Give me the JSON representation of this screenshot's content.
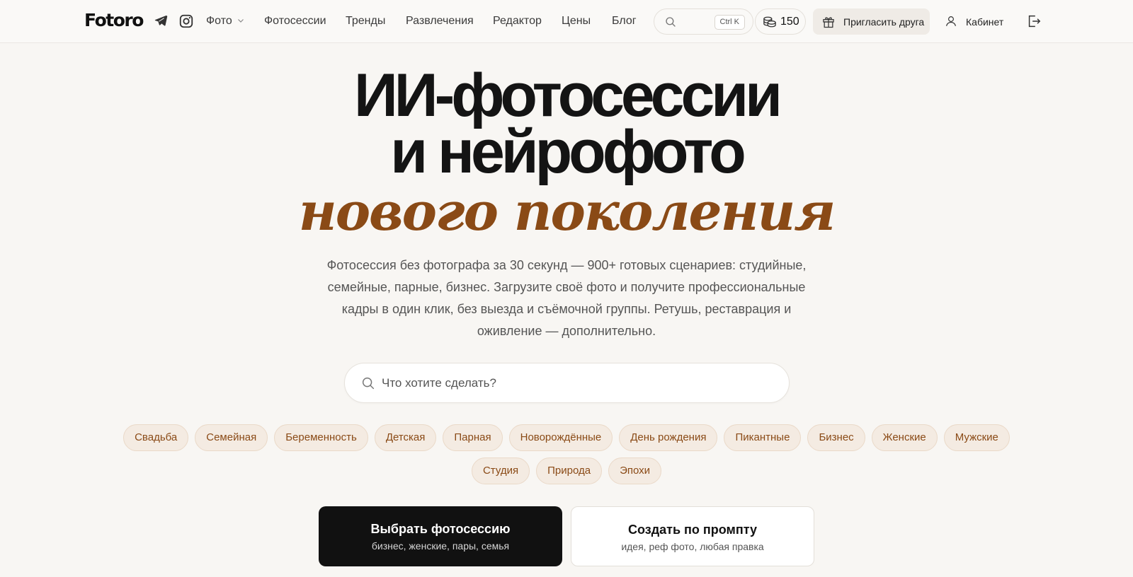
{
  "colors": {
    "accent": "#8a4a16",
    "chip_bg": "#f4ebe2",
    "page_bg": "#f8f6f3",
    "cta_dark": "#111111"
  },
  "header": {
    "logo": "Fotoro",
    "social_icons": [
      "telegram-icon",
      "instagram-icon"
    ],
    "nav": {
      "foto": "Фото",
      "sessions": "Фотосессии",
      "trends": "Тренды",
      "fun": "Развлечения",
      "editor": "Редактор",
      "prices": "Цены",
      "blog": "Блог"
    },
    "search_shortcut": "Ctrl K",
    "credits": "150",
    "invite_label": "Пригласить друга",
    "cabinet_label": "Кабинет"
  },
  "hero": {
    "title_line1": "ИИ-фотосессии",
    "title_line2": "и нейрофото",
    "title_line3": "нового поколения",
    "subtitle": "Фотосессия без фотографа за 30 секунд — 900+ готовых сценариев: студийные, семейные, парные, бизнес. Загрузите своё фото и получите профессиональные кадры в один клик, без выезда и съёмочной группы. Ретушь, реставрация и оживление — дополнительно.",
    "search_placeholder": "Что хотите сделать?"
  },
  "chips_row1": [
    "Свадьба",
    "Семейная",
    "Беременность",
    "Детская",
    "Парная",
    "Новорождённые",
    "День рождения",
    "Пикантные",
    "Бизнес",
    "Женские",
    "Мужские"
  ],
  "chips_row2": [
    "Студия",
    "Природа",
    "Эпохи"
  ],
  "cta": {
    "primary_title": "Выбрать фотосессию",
    "primary_sub": "бизнес, женские, пары, семья",
    "secondary_title": "Создать по промпту",
    "secondary_sub": "идея, реф фото, любая правка"
  }
}
